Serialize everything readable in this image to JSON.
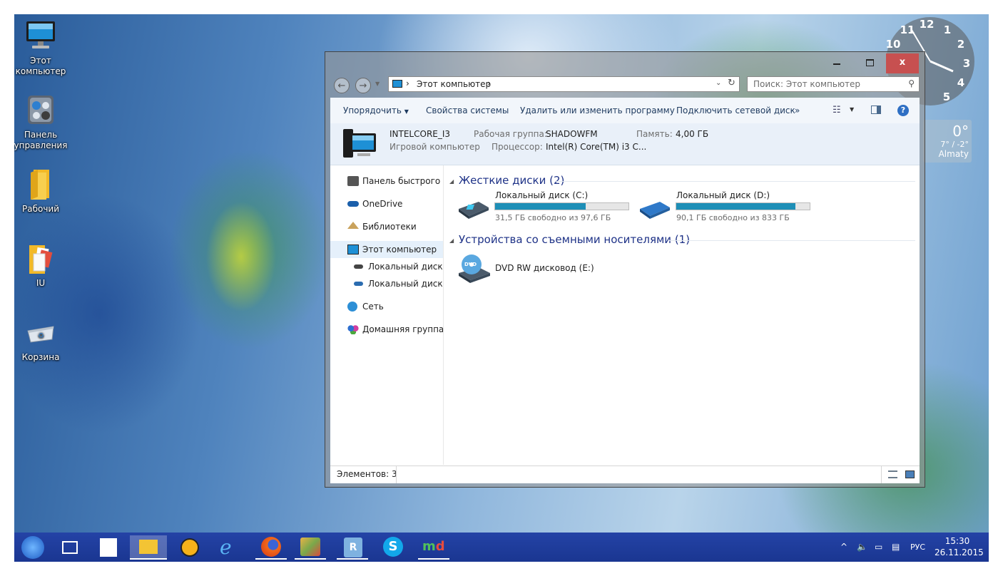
{
  "desktop": {
    "icons": [
      {
        "label": "Этот компьютер"
      },
      {
        "label": "Панель управления"
      },
      {
        "label": "Рабочий"
      },
      {
        "label": "IU"
      },
      {
        "label": "Корзина"
      }
    ],
    "clock_numbers": [
      "11",
      "12",
      "1",
      "10",
      "2",
      "3",
      "4",
      "5"
    ],
    "weather": {
      "temp": "0°",
      "range": "7° / -2°",
      "city": "Almaty"
    }
  },
  "window": {
    "buttons": {
      "minimize": "‒",
      "maximize": "□",
      "close": "x"
    },
    "address": {
      "separator": "›",
      "location": "Этот компьютер",
      "trailing": "›"
    },
    "search": {
      "placeholder": "Поиск: Этот компьютер"
    },
    "commands": [
      "Упорядочить",
      "Свойства системы",
      "Удалить или изменить программу",
      "Подключить сетевой диск",
      "»"
    ],
    "organize_arrow": "▼",
    "details": {
      "name": "INTELCORE_I3",
      "description": "Игровой компьютер",
      "workgroup_label": "Рабочая группа:",
      "workgroup": "SHADOWFM",
      "memory_label": "Память:",
      "memory": "4,00 ГБ",
      "cpu_label": "Процессор:",
      "cpu": "Intel(R) Core(TM) i3 C..."
    },
    "nav_items": [
      {
        "label": "Панель быстрого доступа"
      },
      {
        "label": "OneDrive"
      },
      {
        "label": "Библиотеки"
      },
      {
        "label": "Этот компьютер"
      },
      {
        "label": "Локальный диск (C:)"
      },
      {
        "label": "Локальный диск (D:)"
      },
      {
        "label": "Сеть"
      },
      {
        "label": "Домашняя группа"
      }
    ],
    "groups": [
      {
        "title": "Жесткие диски (2)"
      },
      {
        "title": "Устройства со съемными носителями (1)"
      }
    ],
    "drives": [
      {
        "name": "Локальный диск (C:)",
        "free": "31,5 ГБ свободно из 97,6 ГБ",
        "used_fraction": 0.677,
        "color": "#1e8fb7"
      },
      {
        "name": "Локальный диск (D:)",
        "free": "90,1 ГБ свободно из 833 ГБ",
        "used_fraction": 0.892,
        "color": "#1e8fb7"
      }
    ],
    "removable": [
      {
        "name": "DVD RW дисковод (E:)",
        "badge": "DVD"
      }
    ],
    "status": {
      "items": "Элементов: 3"
    }
  },
  "taskbar": {
    "tray": {
      "language": "РУС",
      "time": "15:30",
      "date": "26.11.2015"
    }
  }
}
